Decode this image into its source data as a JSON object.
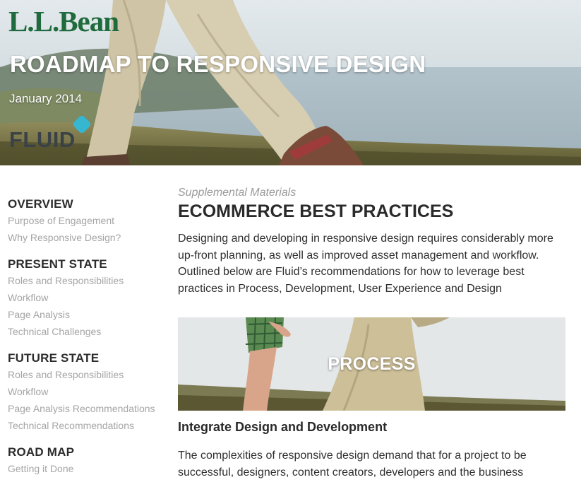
{
  "hero": {
    "brand": "L.L.Bean",
    "title": "ROADMAP TO RESPONSIVE DESIGN",
    "date": "January 2014",
    "agency_logo": "FLUID"
  },
  "sidebar": {
    "sections": [
      {
        "heading": "OVERVIEW",
        "links": [
          "Purpose of Engagement",
          "Why Responsive Design?"
        ]
      },
      {
        "heading": "PRESENT STATE",
        "links": [
          "Roles and Responsibilities",
          "Workflow",
          "Page Analysis",
          "Technical Challenges"
        ]
      },
      {
        "heading": "FUTURE STATE",
        "links": [
          "Roles and Responsibilities",
          "Workflow",
          "Page Analysis Recommendations",
          "Technical Recommendations"
        ]
      },
      {
        "heading": "ROAD MAP",
        "links": [
          "Getting it Done"
        ]
      }
    ]
  },
  "main": {
    "eyebrow": "Supplemental Materials",
    "title": "ECOMMERCE BEST PRACTICES",
    "intro": "Designing and developing in responsive design requires considerably more up-front planning, as well as improved asset management and workflow. Outlined below are Fluid’s recommendations for how to leverage best practices in Process, Development, User Experience and Design",
    "banner_label": "PROCESS",
    "sub_heading": "Integrate Design and Development",
    "body": "The complexities of responsive design demand that for a project to be successful, designers, content creators, developers and the business"
  },
  "colors": {
    "brand_green": "#1f6b3d",
    "fluid_accent": "#36b6d1",
    "nav_link": "#a5a5a5",
    "heading": "#2c2c2c"
  }
}
